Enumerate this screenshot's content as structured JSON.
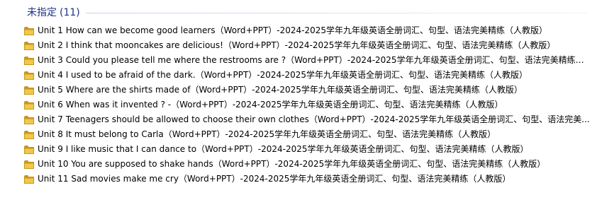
{
  "group": {
    "title": "未指定",
    "count": "(11)"
  },
  "files": [
    {
      "icon": "folder-icon",
      "name": "Unit 1 How can we become good learners（Word+PPT）-2024-2025学年九年级英语全册词汇、句型、语法完美精练（人教版）"
    },
    {
      "icon": "folder-icon",
      "name": "Unit 2 I think that mooncakes are delicious!（Word+PPT）-2024-2025学年九年级英语全册词汇、句型、语法完美精练（人教版）"
    },
    {
      "icon": "folder-icon",
      "name": "Unit 3 Could you please tell me where the restrooms are ?（Word+PPT）-2024-2025学年九年级英语全册词汇、句型、语法完美精练（..."
    },
    {
      "icon": "folder-icon",
      "name": "Unit 4 I used to be afraid of the dark.（Word+PPT）-2024-2025学年九年级英语全册词汇、句型、语法完美精练（人教版）"
    },
    {
      "icon": "folder-icon",
      "name": "Unit 5 Where are the shirts made of（Word+PPT）-2024-2025学年九年级英语全册词汇、句型、语法完美精练（人教版）"
    },
    {
      "icon": "folder-icon",
      "name": "Unit 6 When was it invented ? -（Word+PPT）-2024-2025学年九年级英语全册词汇、句型、语法完美精练（人教版）"
    },
    {
      "icon": "folder-icon",
      "name": "Unit 7 Teenagers should be allowed to choose their own clothes（Word+PPT）-2024-2025学年九年级英语全册词汇、句型、语法完美..."
    },
    {
      "icon": "folder-icon",
      "name": "Unit 8 It must belong to Carla（Word+PPT）-2024-2025学年九年级英语全册词汇、句型、语法完美精练（人教版）"
    },
    {
      "icon": "folder-icon",
      "name": "Unit 9 I like music that I can dance to（Word+PPT）-2024-2025学年九年级英语全册词汇、句型、语法完美精练（人教版）"
    },
    {
      "icon": "folder-icon",
      "name": "Unit 10 You are supposed to shake hands（Word+PPT）-2024-2025学年九年级英语全册词汇、句型、语法完美精练（人教版）"
    },
    {
      "icon": "folder-icon",
      "name": "Unit 11 Sad movies make me cry（Word+PPT）-2024-2025学年九年级英语全册词汇、句型、语法完美精练（人教版）"
    }
  ],
  "colors": {
    "group_title": "#1e3287",
    "folder_fill": "#f0c84a",
    "folder_edge": "#c9961e"
  }
}
